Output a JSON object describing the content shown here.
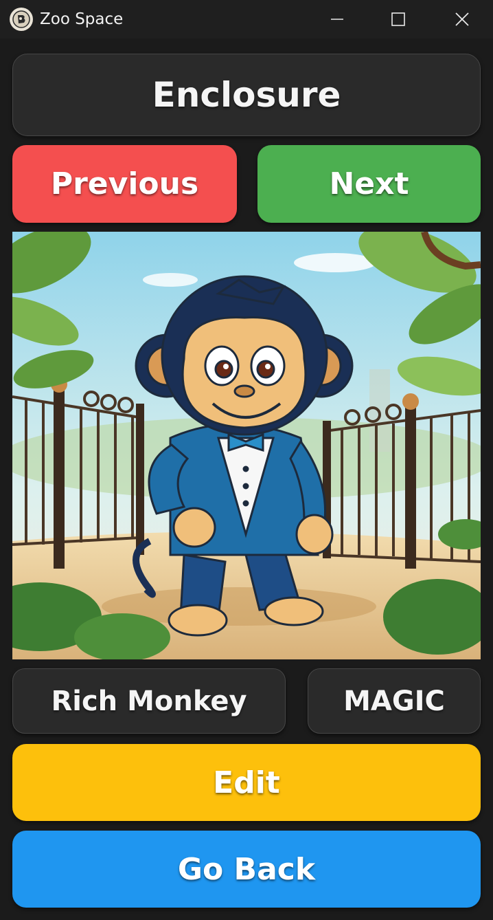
{
  "window": {
    "title": "Zoo Space",
    "app_icon": "zoo-logo-icon",
    "controls": [
      "minimize-icon",
      "maximize-icon",
      "close-icon"
    ]
  },
  "header": {
    "title": "Enclosure"
  },
  "nav": {
    "previous_label": "Previous",
    "next_label": "Next"
  },
  "animal": {
    "image": "cartoon-monkey-in-blue-suit-at-zoo-gate",
    "name": "Rich Monkey",
    "type": "MAGIC"
  },
  "actions": {
    "edit_label": "Edit",
    "back_label": "Go Back"
  },
  "colors": {
    "previous": "#f44f4f",
    "next": "#4caf50",
    "edit": "#fdc00c",
    "back": "#1f96f0",
    "panel": "#2a2a2a",
    "background": "#1b1b1b"
  }
}
